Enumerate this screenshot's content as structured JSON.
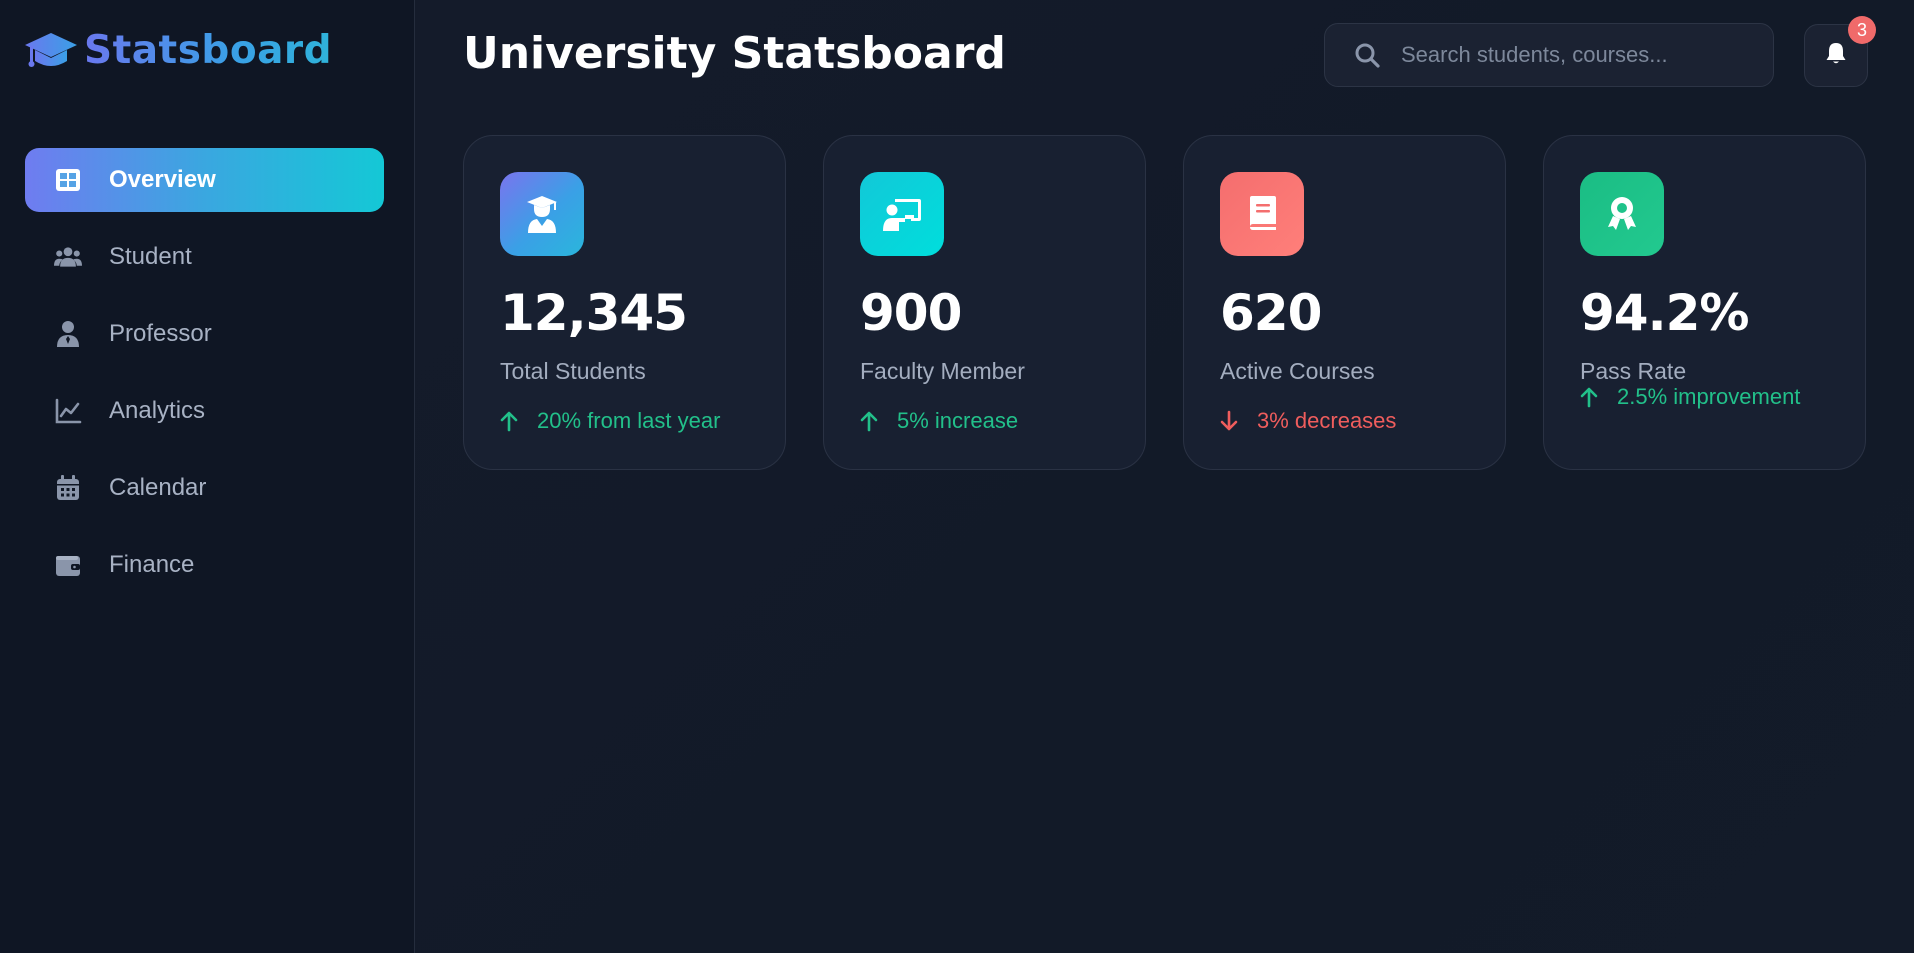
{
  "brand": {
    "name": "Statsboard",
    "icon": "graduation-cap-icon"
  },
  "sidebar": {
    "items": [
      {
        "label": "Overview",
        "icon": "grid-icon",
        "active": true
      },
      {
        "label": "Student",
        "icon": "users-icon",
        "active": false
      },
      {
        "label": "Professor",
        "icon": "professor-icon",
        "active": false
      },
      {
        "label": "Analytics",
        "icon": "chart-line-icon",
        "active": false
      },
      {
        "label": "Calendar",
        "icon": "calendar-icon",
        "active": false
      },
      {
        "label": "Finance",
        "icon": "wallet-icon",
        "active": false
      }
    ]
  },
  "header": {
    "title": "University Statsboard",
    "search_placeholder": "Search students, courses...",
    "notification_count": "3"
  },
  "stats": [
    {
      "value": "12,345",
      "label": "Total Students",
      "trend": "20% from last year",
      "direction": "up",
      "icon": "user-graduate-icon",
      "color": "#4a8fe0"
    },
    {
      "value": "900",
      "label": "Faculty Member",
      "trend": "5% increase",
      "direction": "up",
      "icon": "chalkboard-teacher-icon",
      "color": "#00d4d8"
    },
    {
      "value": "620",
      "label": "Active Courses",
      "trend": "3% decreases",
      "direction": "down",
      "icon": "book-icon",
      "color": "#f46e6e"
    },
    {
      "value": "94.2%",
      "label": "Pass Rate",
      "trend": "2.5% improvement",
      "direction": "up",
      "icon": "award-icon",
      "color": "#1fc38a"
    }
  ],
  "colors": {
    "accent_start": "#6f7cf0",
    "accent_end": "#14c8d6",
    "positive": "#22c08a",
    "negative": "#ef5d5d"
  }
}
